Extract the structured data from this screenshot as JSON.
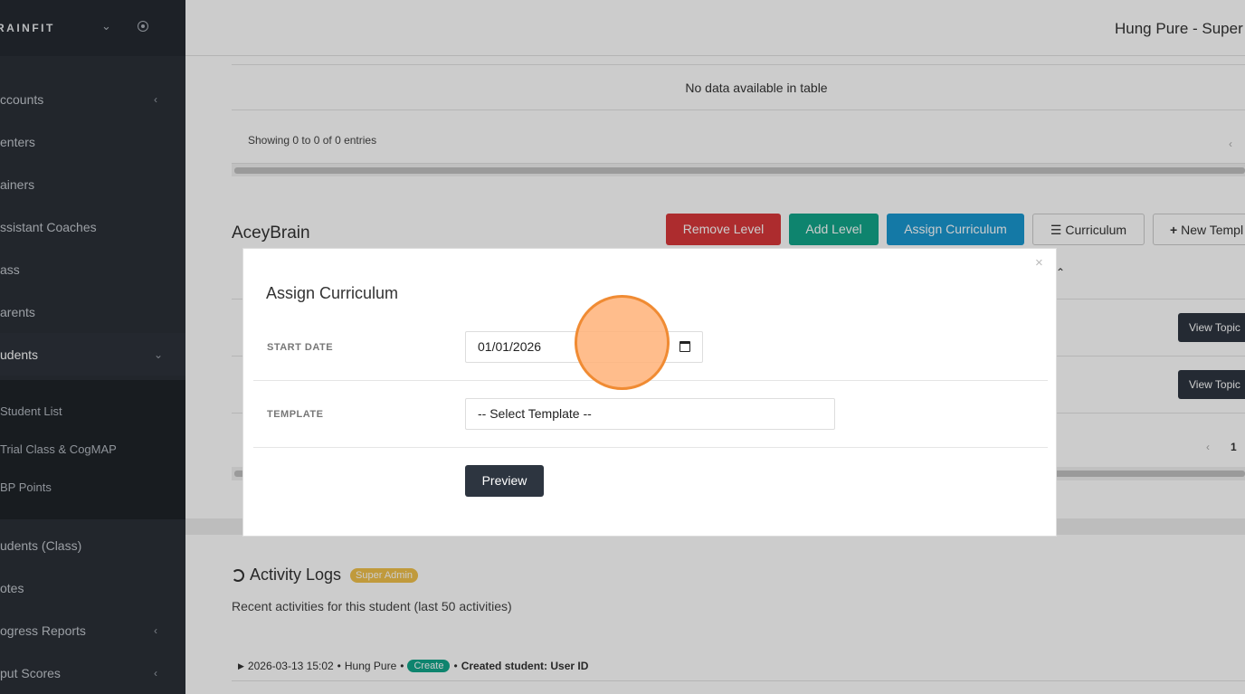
{
  "sidebar": {
    "brand": "RAINFIT",
    "items": [
      {
        "label": "ccounts",
        "arrow": "‹"
      },
      {
        "label": "enters",
        "arrow": ""
      },
      {
        "label": "ainers",
        "arrow": ""
      },
      {
        "label": "ssistant Coaches",
        "arrow": ""
      },
      {
        "label": "ass",
        "arrow": ""
      },
      {
        "label": "arents",
        "arrow": ""
      },
      {
        "label": "udents",
        "arrow": "⌄"
      },
      {
        "label": "udents (Class)",
        "arrow": ""
      },
      {
        "label": "otes",
        "arrow": ""
      },
      {
        "label": "ogress Reports",
        "arrow": "‹"
      },
      {
        "label": "put Scores",
        "arrow": "‹"
      }
    ],
    "subitems": [
      {
        "label": "Student List"
      },
      {
        "label": "Trial Class & CogMAP"
      },
      {
        "label": "BP Points"
      }
    ]
  },
  "topbar": {
    "user": "Hung Pure - Super A"
  },
  "table1": {
    "empty_text": "No data available in table",
    "showing": "Showing 0 to 0 of 0 entries",
    "prev": "‹"
  },
  "section": {
    "title": "AceyBrain",
    "buttons": {
      "remove_level": "Remove Level",
      "add_level": "Add Level",
      "assign_curriculum": "Assign Curriculum",
      "curriculum": "Curriculum",
      "new_template": "New Templ"
    },
    "row_buttons": [
      "View Topic",
      "View Topic"
    ],
    "page_number": "1",
    "prev": "‹"
  },
  "activity": {
    "title": "Activity Logs",
    "badge": "Super Admin",
    "subtitle": "Recent activities for this student (last 50 activities)",
    "log": {
      "timestamp": "2026-03-13 15:02",
      "user": "Hung Pure",
      "action": "Create",
      "detail": "Created student: User ID"
    }
  },
  "modal": {
    "title": "Assign Curriculum",
    "close": "×",
    "start_date_label": "START DATE",
    "start_date_value": "01/01/2026",
    "template_label": "TEMPLATE",
    "template_value": "-- Select Template --",
    "preview_button": "Preview"
  },
  "colors": {
    "sidebar_bg": "#2b3038",
    "remove_red": "#d9383a",
    "add_green": "#12a68a",
    "assign_blue": "#1a98d0",
    "dark_button": "#2d3540",
    "badge_yellow": "#f0c14b",
    "click_indicator": "#f08b33"
  }
}
